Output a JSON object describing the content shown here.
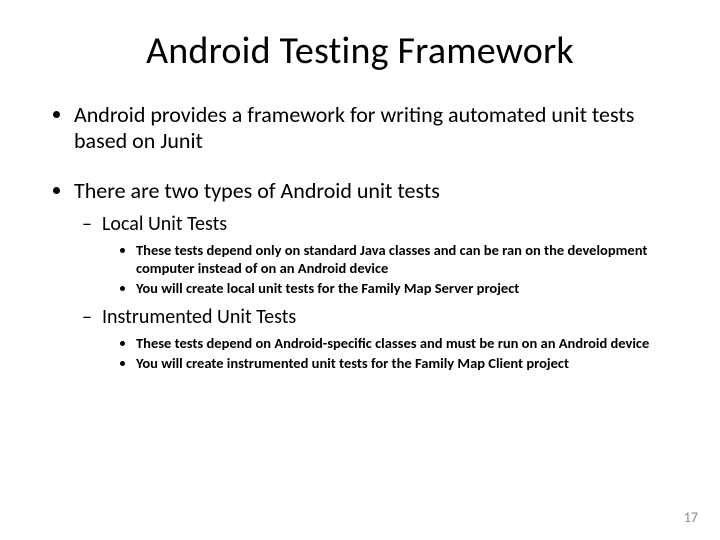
{
  "title": "Android Testing Framework",
  "bullets": {
    "b1": "Android provides a framework for writing automated unit tests based on Junit",
    "b2": "There are two types of Android unit tests",
    "b2_1": "Local Unit Tests",
    "b2_1_1": "These tests depend only on standard Java classes and can be ran on the development computer instead of on an Android device",
    "b2_1_2": "You will create local unit tests for the Family Map Server project",
    "b2_2": "Instrumented Unit Tests",
    "b2_2_1": "These tests depend on Android-specific classes and must be run on an Android device",
    "b2_2_2": "You will create instrumented unit tests for the Family Map Client project"
  },
  "page_number": "17"
}
